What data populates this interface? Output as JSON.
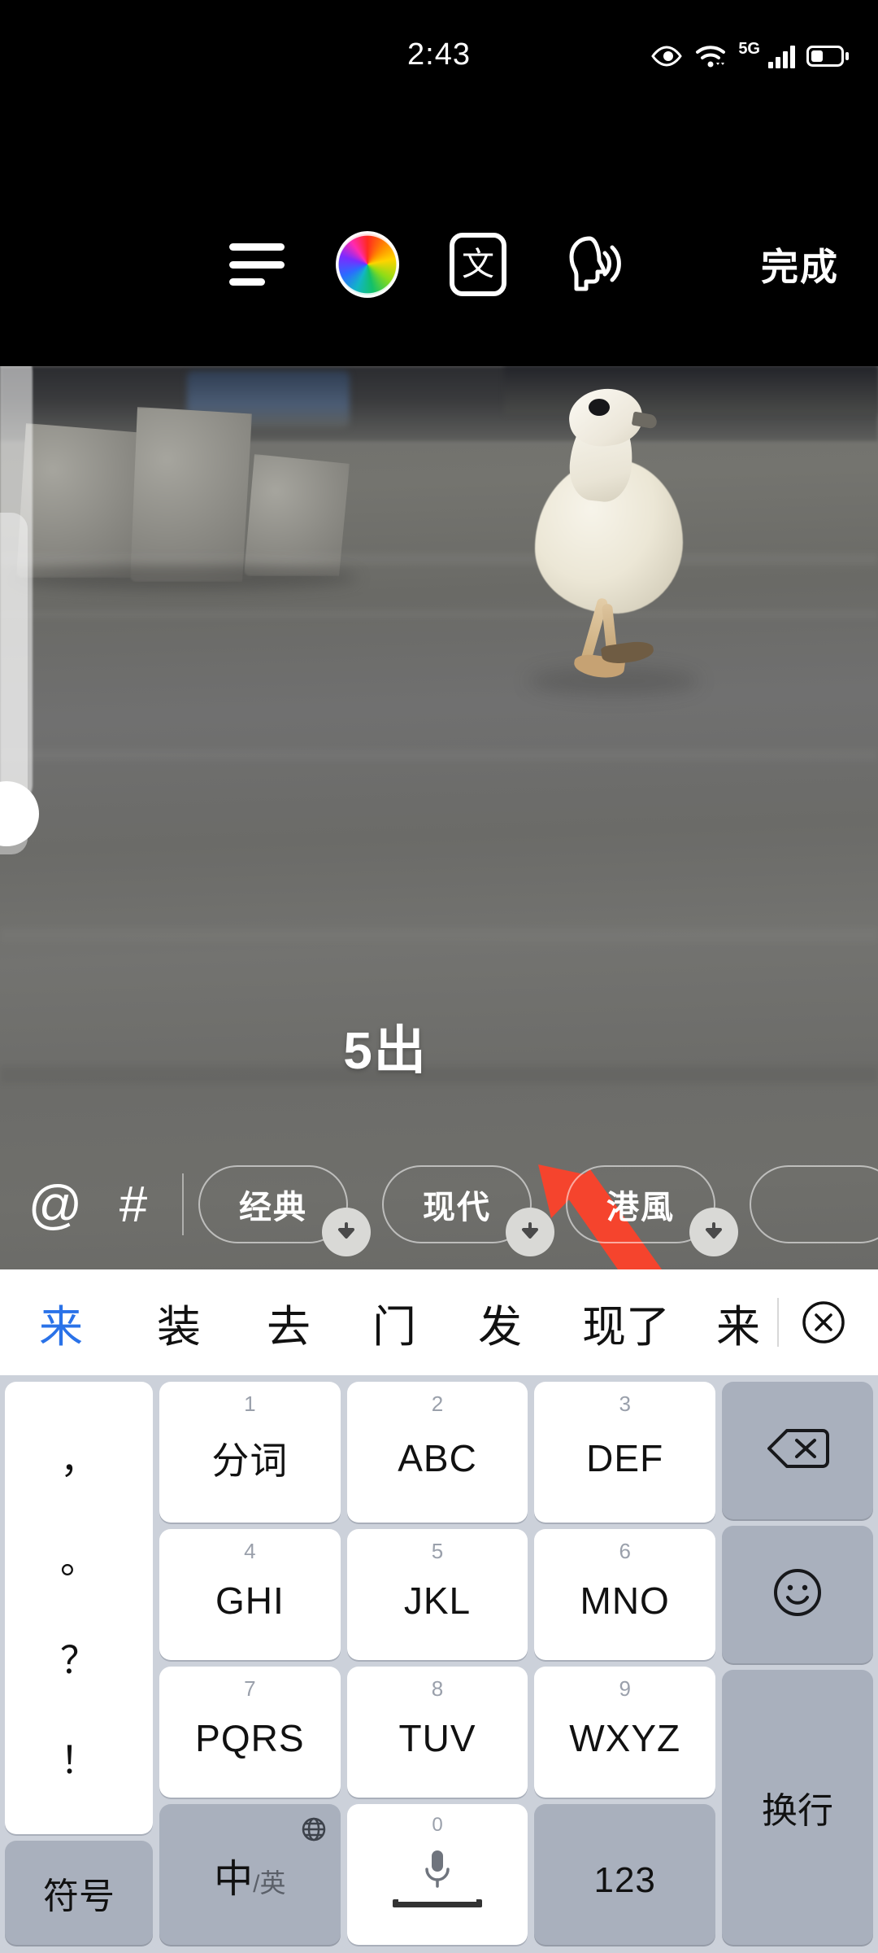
{
  "status_bar": {
    "time": "2:43",
    "network_label": "5G",
    "icons": [
      "eye-icon",
      "wifi-icon",
      "signal-icon",
      "battery-icon"
    ]
  },
  "editor_toolbar": {
    "buttons": [
      {
        "name": "text-align-icon",
        "label": ""
      },
      {
        "name": "color-wheel-icon",
        "label": ""
      },
      {
        "name": "font-style-icon",
        "label": "文"
      },
      {
        "name": "text-to-speech-icon",
        "label": ""
      }
    ],
    "done_label": "完成",
    "font_style_glyph": "文"
  },
  "canvas": {
    "overlay_text": "5出",
    "arrow_color": "#F5442D",
    "scene_description": "white duck walking on grey concrete"
  },
  "chip_bar": {
    "mention_icon": "@",
    "hashtag_icon": "#",
    "chips": [
      {
        "label": "经典",
        "active": false,
        "download_badge": "download-arrow-icon"
      },
      {
        "label": "现代",
        "active": true,
        "download_badge": "download-arrow-icon"
      },
      {
        "label": "港風",
        "active": false,
        "download_badge": "download-arrow-icon"
      },
      {
        "label": "",
        "active": false,
        "download_badge": ""
      }
    ]
  },
  "candidate_bar": {
    "candidates": [
      "来",
      "装",
      "去",
      "门",
      "发",
      "现了",
      "来"
    ],
    "selected_index": 0,
    "close_icon": "close-circle-icon"
  },
  "keyboard": {
    "punctuation_key": [
      "，",
      "。",
      "？",
      "！"
    ],
    "rows": [
      [
        {
          "num": "1",
          "label": "分词"
        },
        {
          "num": "2",
          "label": "ABC"
        },
        {
          "num": "3",
          "label": "DEF"
        }
      ],
      [
        {
          "num": "4",
          "label": "GHI"
        },
        {
          "num": "5",
          "label": "JKL"
        },
        {
          "num": "6",
          "label": "MNO"
        }
      ],
      [
        {
          "num": "7",
          "label": "PQRS"
        },
        {
          "num": "8",
          "label": "TUV"
        },
        {
          "num": "9",
          "label": "WXYZ"
        }
      ]
    ],
    "bottom_row": {
      "symbols_label": "符号",
      "lang_primary": "中",
      "lang_sep": "/",
      "lang_secondary": "英",
      "globe_icon": "globe-icon",
      "space_num": "0",
      "space_icon": "microphone-icon",
      "numeric_label": "123"
    },
    "side_keys": {
      "backspace_icon": "backspace-icon",
      "emoji_icon": "emoji-smiley-icon",
      "return_label": "换行"
    },
    "colors": {
      "background": "#CCD1DA",
      "key": "#FFFFFF",
      "function_key": "#A9B0BD",
      "selected_candidate": "#2A72E8"
    }
  }
}
